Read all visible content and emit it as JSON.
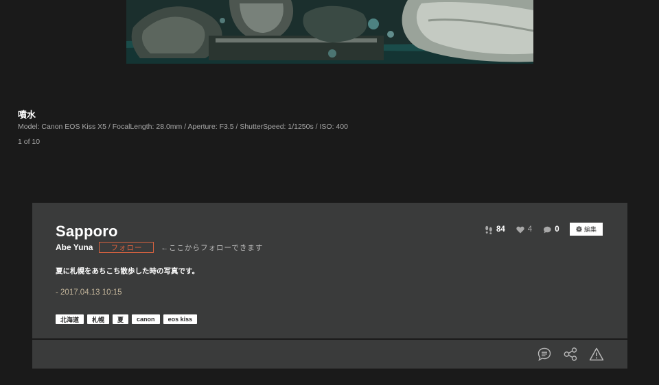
{
  "photo": {
    "title": "噴水",
    "exif": "Model: Canon EOS Kiss X5 / FocalLength: 28.0mm / Aperture: F3.5 / ShutterSpeed: 1/1250s / ISO: 400",
    "counter": "1 of 10"
  },
  "card": {
    "title": "Sapporo",
    "author": "Abe Yuna",
    "follow_label": "フォロー",
    "follow_hint": "←ここからフォローできます",
    "description": "夏に札幌をあちこち散歩した時の写真です。",
    "date": "- 2017.04.13 10:15",
    "tags": [
      "北海道",
      "札幌",
      "夏",
      "canon",
      "eos kiss"
    ],
    "stats": {
      "views": "84",
      "likes": "4",
      "comments": "0"
    },
    "edit_label": "編集"
  },
  "icons": {
    "views": "footprints-icon",
    "likes": "heart-icon",
    "comments": "speech-bubble-icon",
    "edit": "gear-icon",
    "comment_action": "comment-icon",
    "share_action": "share-icon",
    "report_action": "warning-icon"
  },
  "colors": {
    "background": "#1a1a1a",
    "card": "#3a3b3b",
    "accent": "#d9623f",
    "date": "#c2b49a"
  }
}
